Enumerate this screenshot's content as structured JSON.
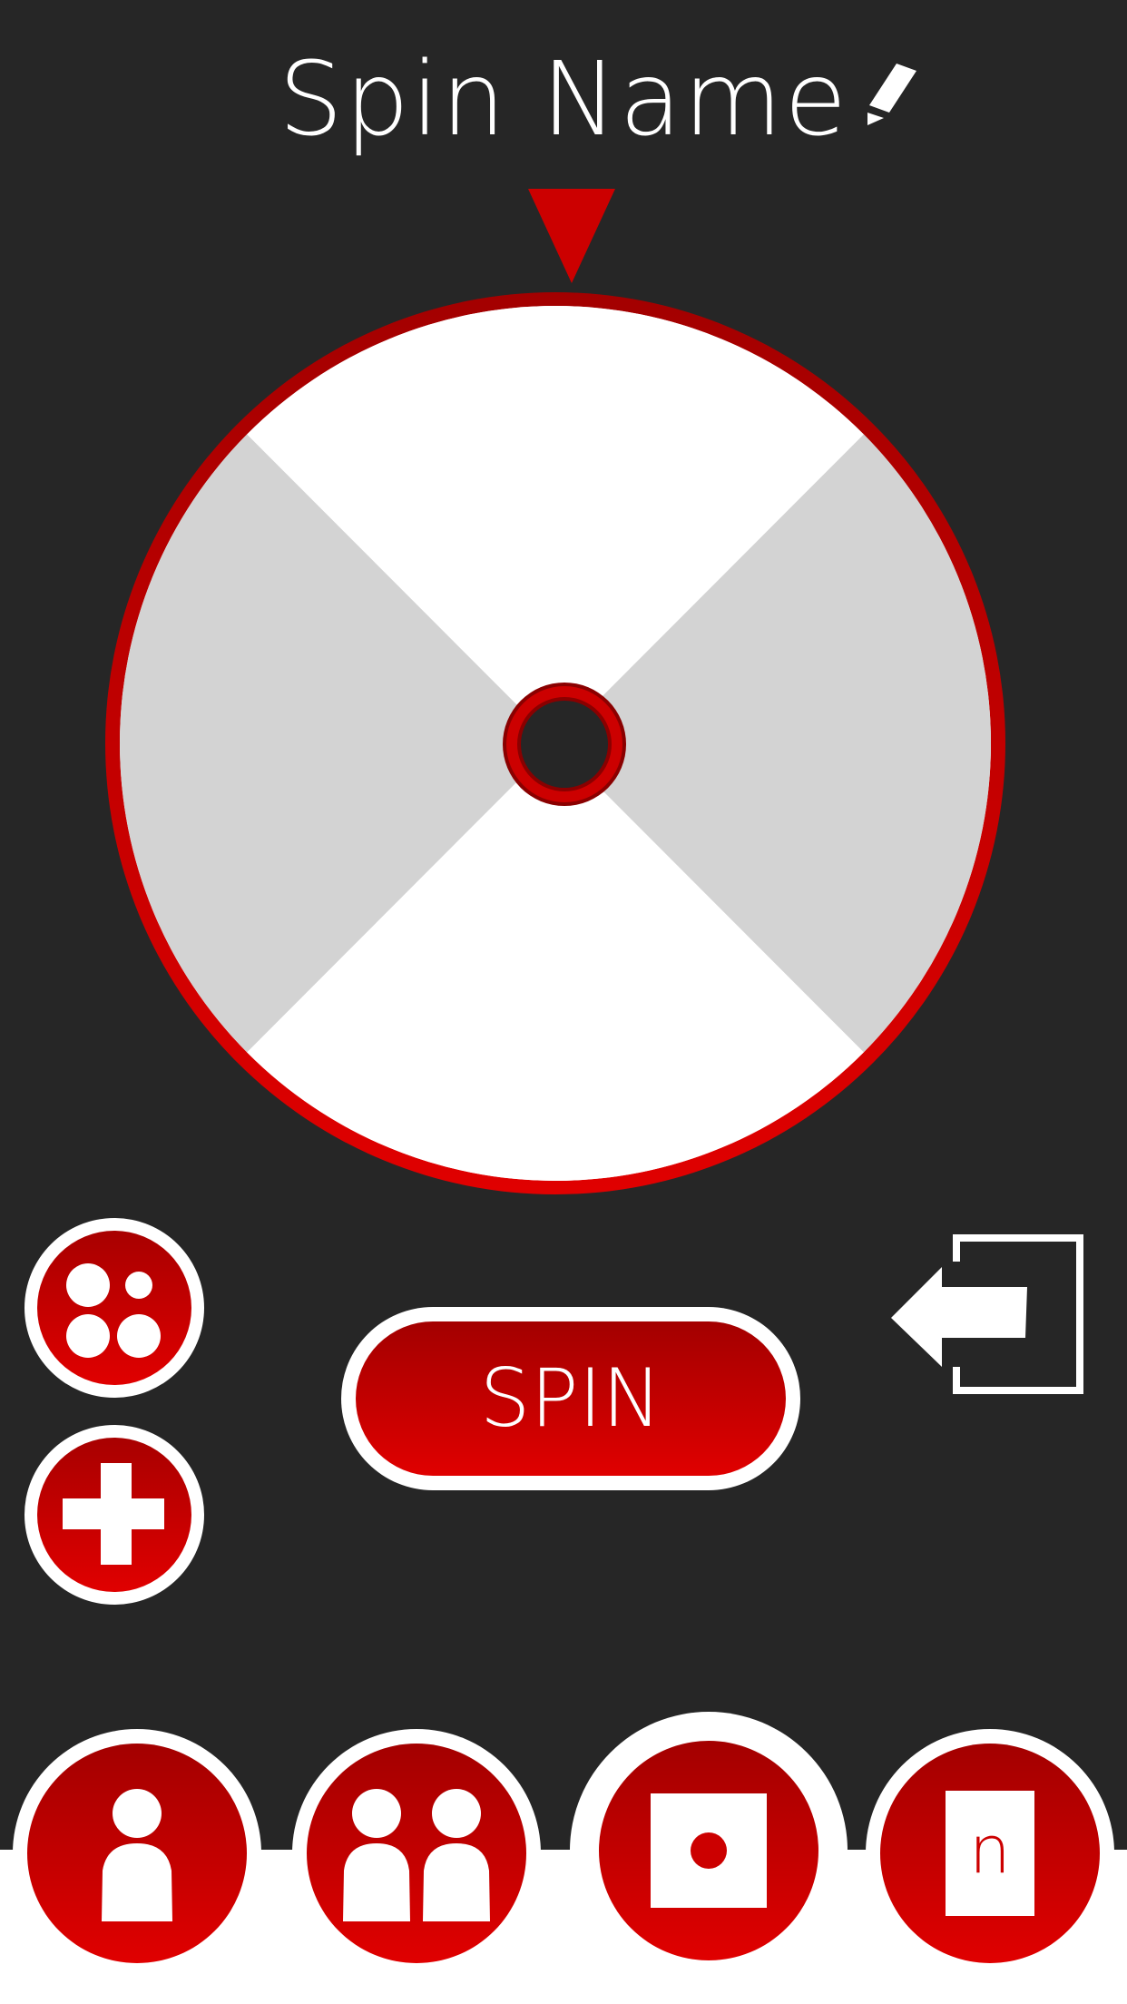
{
  "header": {
    "title": "Spin Name",
    "edit_icon": "pencil-icon"
  },
  "wheel": {
    "segment_colors": [
      "#ffffff",
      "#d3d3d3",
      "#ffffff",
      "#d3d3d3"
    ],
    "rim_color": "#cc0000"
  },
  "controls": {
    "spin_label": "SPIN",
    "mode_icon": "dots-icon",
    "add_icon": "plus-icon",
    "exit_icon": "exit-arrow-icon"
  },
  "tabs": [
    {
      "icon": "single-person-icon"
    },
    {
      "icon": "two-people-icon"
    },
    {
      "icon": "die-one-icon",
      "selected": true
    },
    {
      "icon": "die-n-icon",
      "label": "n"
    }
  ],
  "colors": {
    "background": "#262626",
    "accent": "#cc0000",
    "accent_dark": "#a30000"
  }
}
